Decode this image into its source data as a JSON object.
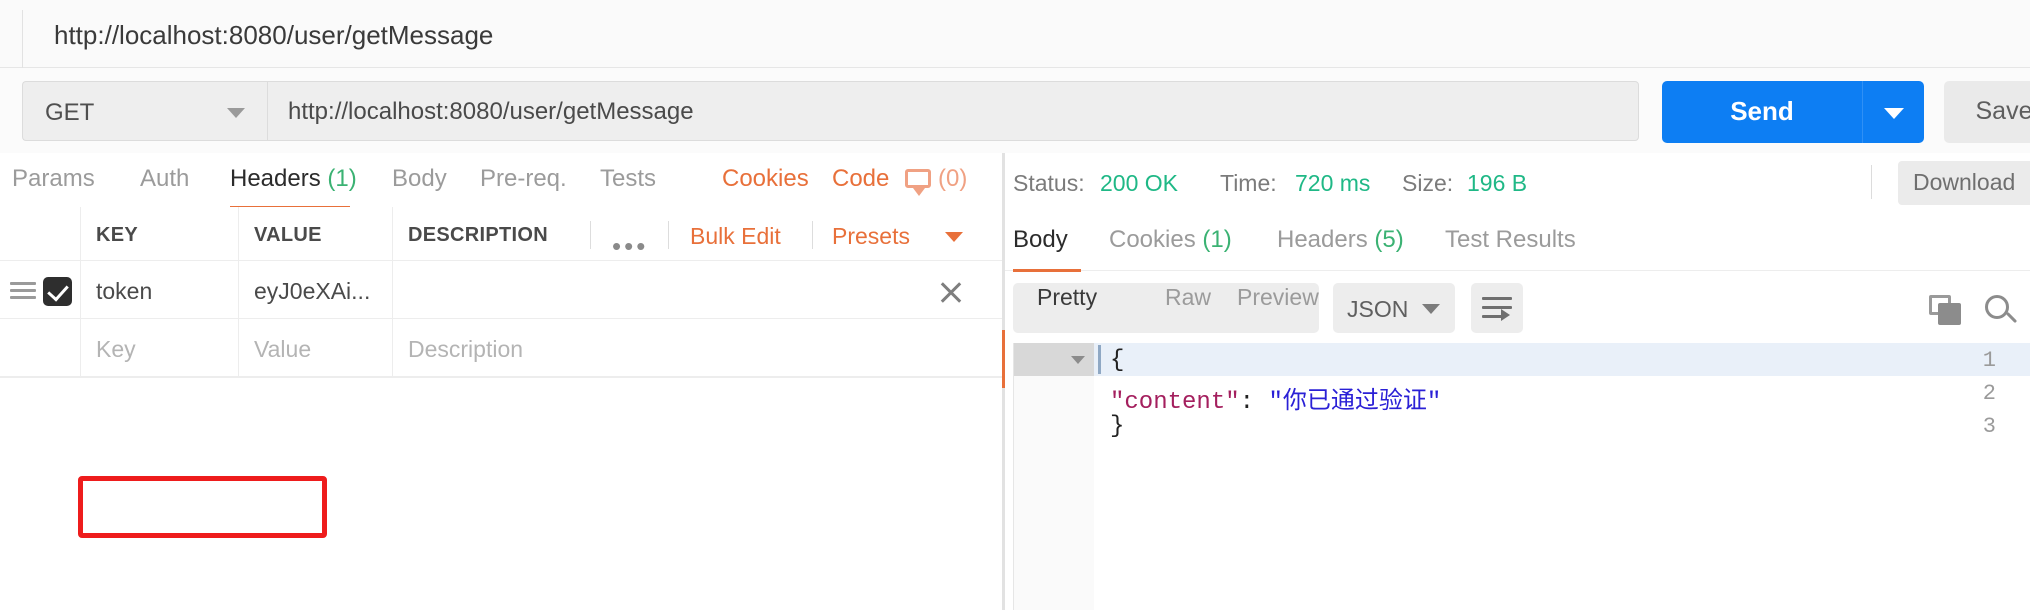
{
  "tab": {
    "title": "http://localhost:8080/user/getMessage"
  },
  "request_bar": {
    "method": "GET",
    "url": "http://localhost:8080/user/getMessage",
    "send_label": "Send",
    "save_label": "Save"
  },
  "request_tabs": [
    {
      "label": "Params",
      "count": "",
      "active": false
    },
    {
      "label": "Auth",
      "count": "",
      "active": false
    },
    {
      "label": "Headers",
      "count": "(1)",
      "active": true
    },
    {
      "label": "Body",
      "count": "",
      "active": false
    },
    {
      "label": "Pre-req.",
      "count": "",
      "active": false
    },
    {
      "label": "Tests",
      "count": "",
      "active": false
    }
  ],
  "request_tabs_right": {
    "cookies": "Cookies",
    "code": "Code",
    "comment_count": "(0)"
  },
  "headers_table": {
    "columns": [
      "KEY",
      "VALUE",
      "DESCRIPTION"
    ],
    "more_label": "•••",
    "bulk_edit_label": "Bulk Edit",
    "presets_label": "Presets",
    "rows": [
      {
        "checked": true,
        "key": "token",
        "value": "eyJ0eXAi...",
        "description": ""
      }
    ],
    "placeholders": {
      "key": "Key",
      "value": "Value",
      "description": "Description"
    }
  },
  "response": {
    "status_label": "Status:",
    "status_value": "200 OK",
    "time_label": "Time:",
    "time_value": "720 ms",
    "size_label": "Size:",
    "size_value": "196 B",
    "download_label": "Download",
    "tabs": [
      {
        "label": "Body",
        "count": "",
        "active": true
      },
      {
        "label": "Cookies",
        "count": "(1)",
        "active": false
      },
      {
        "label": "Headers",
        "count": "(5)",
        "active": false
      },
      {
        "label": "Test Results",
        "count": "",
        "active": false
      }
    ],
    "formats": [
      {
        "label": "Pretty",
        "active": true
      },
      {
        "label": "Raw",
        "active": false
      },
      {
        "label": "Preview",
        "active": false
      }
    ],
    "language": "JSON",
    "body_lines": [
      {
        "number": "1",
        "text": "{"
      },
      {
        "number": "2",
        "text": "    \"content\": \"你已通过验证\""
      },
      {
        "number": "3",
        "text": "}"
      }
    ],
    "body_json": {
      "content": "你已通过验证"
    }
  },
  "colors": {
    "accent_orange": "#e8703a",
    "send_blue": "#0d7ef3",
    "status_green": "#1fb886",
    "annotation_red": "#ee1c1c",
    "json_key": "#a41f5e",
    "json_string": "#2a20d6"
  }
}
